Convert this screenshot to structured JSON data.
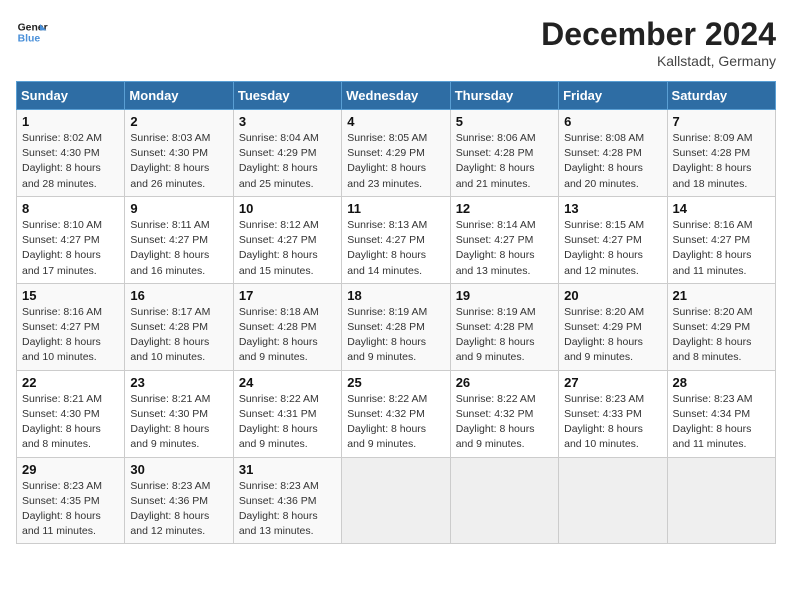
{
  "header": {
    "logo_line1": "General",
    "logo_line2": "Blue",
    "month": "December 2024",
    "location": "Kallstadt, Germany"
  },
  "days_of_week": [
    "Sunday",
    "Monday",
    "Tuesday",
    "Wednesday",
    "Thursday",
    "Friday",
    "Saturday"
  ],
  "weeks": [
    [
      {
        "day": 1,
        "sunrise": "8:02 AM",
        "sunset": "4:30 PM",
        "daylight": "8 hours and 28 minutes."
      },
      {
        "day": 2,
        "sunrise": "8:03 AM",
        "sunset": "4:30 PM",
        "daylight": "8 hours and 26 minutes."
      },
      {
        "day": 3,
        "sunrise": "8:04 AM",
        "sunset": "4:29 PM",
        "daylight": "8 hours and 25 minutes."
      },
      {
        "day": 4,
        "sunrise": "8:05 AM",
        "sunset": "4:29 PM",
        "daylight": "8 hours and 23 minutes."
      },
      {
        "day": 5,
        "sunrise": "8:06 AM",
        "sunset": "4:28 PM",
        "daylight": "8 hours and 21 minutes."
      },
      {
        "day": 6,
        "sunrise": "8:08 AM",
        "sunset": "4:28 PM",
        "daylight": "8 hours and 20 minutes."
      },
      {
        "day": 7,
        "sunrise": "8:09 AM",
        "sunset": "4:28 PM",
        "daylight": "8 hours and 18 minutes."
      }
    ],
    [
      {
        "day": 8,
        "sunrise": "8:10 AM",
        "sunset": "4:27 PM",
        "daylight": "8 hours and 17 minutes."
      },
      {
        "day": 9,
        "sunrise": "8:11 AM",
        "sunset": "4:27 PM",
        "daylight": "8 hours and 16 minutes."
      },
      {
        "day": 10,
        "sunrise": "8:12 AM",
        "sunset": "4:27 PM",
        "daylight": "8 hours and 15 minutes."
      },
      {
        "day": 11,
        "sunrise": "8:13 AM",
        "sunset": "4:27 PM",
        "daylight": "8 hours and 14 minutes."
      },
      {
        "day": 12,
        "sunrise": "8:14 AM",
        "sunset": "4:27 PM",
        "daylight": "8 hours and 13 minutes."
      },
      {
        "day": 13,
        "sunrise": "8:15 AM",
        "sunset": "4:27 PM",
        "daylight": "8 hours and 12 minutes."
      },
      {
        "day": 14,
        "sunrise": "8:16 AM",
        "sunset": "4:27 PM",
        "daylight": "8 hours and 11 minutes."
      }
    ],
    [
      {
        "day": 15,
        "sunrise": "8:16 AM",
        "sunset": "4:27 PM",
        "daylight": "8 hours and 10 minutes."
      },
      {
        "day": 16,
        "sunrise": "8:17 AM",
        "sunset": "4:28 PM",
        "daylight": "8 hours and 10 minutes."
      },
      {
        "day": 17,
        "sunrise": "8:18 AM",
        "sunset": "4:28 PM",
        "daylight": "8 hours and 9 minutes."
      },
      {
        "day": 18,
        "sunrise": "8:19 AM",
        "sunset": "4:28 PM",
        "daylight": "8 hours and 9 minutes."
      },
      {
        "day": 19,
        "sunrise": "8:19 AM",
        "sunset": "4:28 PM",
        "daylight": "8 hours and 9 minutes."
      },
      {
        "day": 20,
        "sunrise": "8:20 AM",
        "sunset": "4:29 PM",
        "daylight": "8 hours and 9 minutes."
      },
      {
        "day": 21,
        "sunrise": "8:20 AM",
        "sunset": "4:29 PM",
        "daylight": "8 hours and 8 minutes."
      }
    ],
    [
      {
        "day": 22,
        "sunrise": "8:21 AM",
        "sunset": "4:30 PM",
        "daylight": "8 hours and 8 minutes."
      },
      {
        "day": 23,
        "sunrise": "8:21 AM",
        "sunset": "4:30 PM",
        "daylight": "8 hours and 9 minutes."
      },
      {
        "day": 24,
        "sunrise": "8:22 AM",
        "sunset": "4:31 PM",
        "daylight": "8 hours and 9 minutes."
      },
      {
        "day": 25,
        "sunrise": "8:22 AM",
        "sunset": "4:32 PM",
        "daylight": "8 hours and 9 minutes."
      },
      {
        "day": 26,
        "sunrise": "8:22 AM",
        "sunset": "4:32 PM",
        "daylight": "8 hours and 9 minutes."
      },
      {
        "day": 27,
        "sunrise": "8:23 AM",
        "sunset": "4:33 PM",
        "daylight": "8 hours and 10 minutes."
      },
      {
        "day": 28,
        "sunrise": "8:23 AM",
        "sunset": "4:34 PM",
        "daylight": "8 hours and 11 minutes."
      }
    ],
    [
      {
        "day": 29,
        "sunrise": "8:23 AM",
        "sunset": "4:35 PM",
        "daylight": "8 hours and 11 minutes."
      },
      {
        "day": 30,
        "sunrise": "8:23 AM",
        "sunset": "4:36 PM",
        "daylight": "8 hours and 12 minutes."
      },
      {
        "day": 31,
        "sunrise": "8:23 AM",
        "sunset": "4:36 PM",
        "daylight": "8 hours and 13 minutes."
      },
      null,
      null,
      null,
      null
    ]
  ],
  "labels": {
    "sunrise": "Sunrise:",
    "sunset": "Sunset:",
    "daylight": "Daylight:"
  }
}
